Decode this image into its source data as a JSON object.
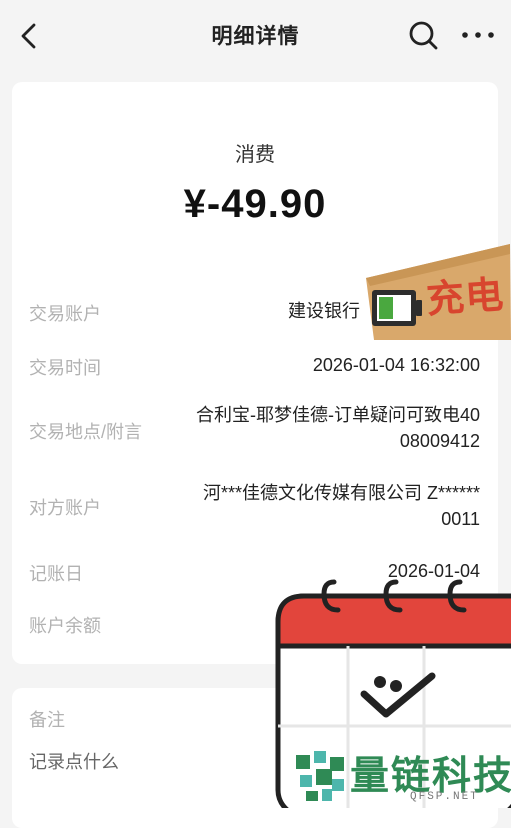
{
  "header": {
    "title": "明细详情",
    "back_icon": "chevron-left-icon",
    "search_icon": "search-icon",
    "more_icon": "more-horizontal-icon"
  },
  "detail": {
    "type": "消费",
    "amount": "¥-49.90",
    "rows": [
      {
        "label": "交易账户",
        "value": "建设银行"
      },
      {
        "label": "交易时间",
        "value": "2026-01-04 16:32:00"
      },
      {
        "label": "交易地点/附言",
        "value_line1": "合利宝-耶梦佳德-订单疑问可致电40",
        "value_line2": "08009412"
      },
      {
        "label": "对方账户",
        "value_line1": "河***佳德文化传媒有限公司 Z******",
        "value_line2": "0011"
      },
      {
        "label": "记账日",
        "value": "2026-01-04"
      },
      {
        "label": "账户余额",
        "value": ""
      }
    ]
  },
  "note": {
    "label": "备注",
    "placeholder": "记录点什么"
  },
  "overlays": {
    "charge_sticker_text": "充电",
    "watermark_text": "量链科技",
    "watermark_url": "QFSP.NET",
    "colors": {
      "sticker_red": "#d8452e",
      "sticker_green": "#3f9a3a",
      "calendar_red": "#e2453c",
      "watermark_green": "#2f8a55"
    }
  }
}
